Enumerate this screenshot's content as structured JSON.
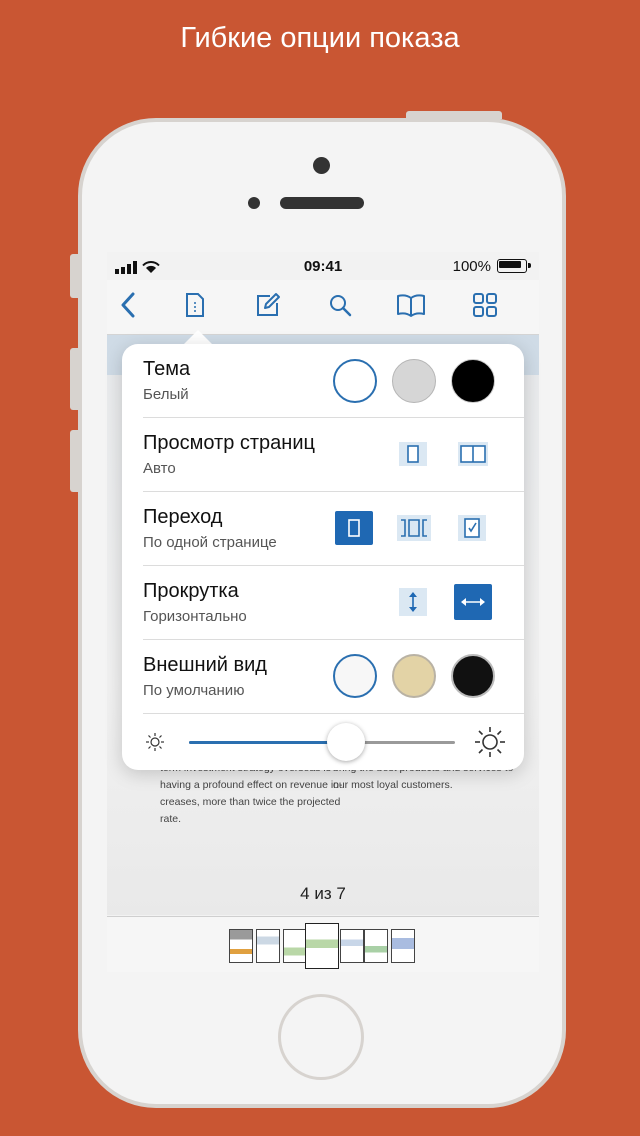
{
  "headline": "Гибкие опции показа",
  "status": {
    "time": "09:41",
    "battery": "100%"
  },
  "toolbar": {
    "items": [
      "back-icon",
      "document-icon",
      "edit-icon",
      "search-icon",
      "book-icon",
      "grid-icon"
    ],
    "accent": "#2a6fb0"
  },
  "popover": {
    "theme": {
      "title": "Тема",
      "value": "Белый",
      "options": [
        "#ffffff",
        "#d6d6d6",
        "#000000"
      ],
      "selected": 0
    },
    "page_view": {
      "title": "Просмотр страниц",
      "value": "Авто",
      "options": [
        "single-page-icon",
        "two-page-icon"
      ]
    },
    "transition": {
      "title": "Переход",
      "value": "По одной странице",
      "options": [
        "single-page-icon",
        "continuous-page-icon",
        "page-curl-icon"
      ],
      "selected": 0
    },
    "scrolling": {
      "title": "Прокрутка",
      "value": "Горизонтально",
      "options": [
        "vertical-scroll-icon",
        "horizontal-scroll-icon"
      ],
      "selected": 1
    },
    "appearance": {
      "title": "Внешний вид",
      "value": "По умолчанию",
      "options": [
        "#f7f7f7",
        "#e3d3a6",
        "#111111"
      ],
      "selected": 0
    },
    "brightness": 0.59
  },
  "document": {
    "col1": "term investment strategy overseas is\nhaving a profound effect on revenue in-\ncreases, more than twice the projected\nrate.",
    "col2": "bring the best products and services to\nour most loyal customers."
  },
  "page_indicator": "4 из 7"
}
